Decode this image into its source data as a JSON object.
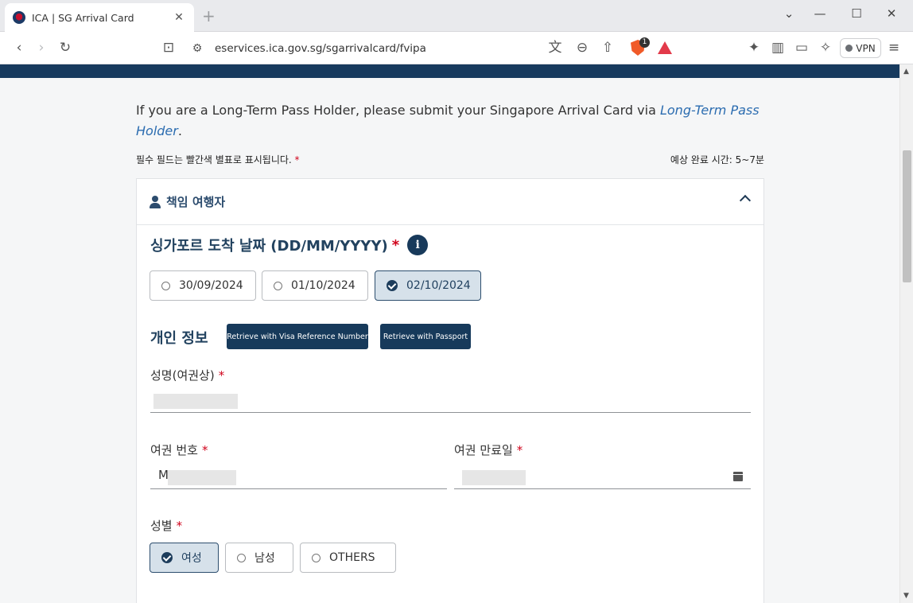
{
  "browser": {
    "tab_title": "ICA | SG Arrival Card",
    "tab_close": "✕",
    "new_tab": "+",
    "url": "eservices.ica.gov.sg/sgarrivalcard/fvipa",
    "shield_count": "1",
    "vpn_label": "VPN",
    "accent_color": "#f05a28"
  },
  "page": {
    "info_text": "If you are a Long-Term Pass Holder, please submit your Singapore Arrival Card via ",
    "info_link": "Long-Term Pass Holder",
    "info_end": ".",
    "required_note": "필수 필드는 빨간색 별표로 표시됩니다.",
    "required_star": "*",
    "eta": "예상 완료 시간: 5~7분",
    "brand_color": "#173a5e"
  },
  "section": {
    "title": "책임 여행자",
    "arrival_label": "싱가포르 도착 날짜 (DD/MM/YYYY)",
    "info_glyph": "i",
    "dates": [
      {
        "label": "30/09/2024",
        "selected": false
      },
      {
        "label": "01/10/2024",
        "selected": false
      },
      {
        "label": "02/10/2024",
        "selected": true
      }
    ],
    "personal_heading": "개인 정보",
    "retrieve_visa": "Retrieve with Visa Reference Number",
    "retrieve_passport": "Retrieve with Passport"
  },
  "fields": {
    "name_label": "성명(여권상)",
    "passport_label": "여권 번호",
    "passport_prefix": "M",
    "expiry_label": "여권 만료일",
    "gender_label": "성별",
    "genders": [
      {
        "label": "여성",
        "selected": true
      },
      {
        "label": "남성",
        "selected": false
      },
      {
        "label": "OTHERS",
        "selected": false
      }
    ]
  }
}
